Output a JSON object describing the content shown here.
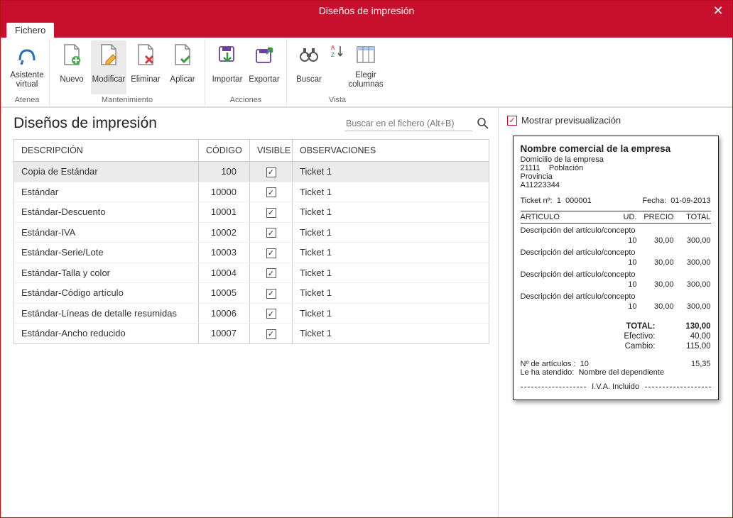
{
  "window": {
    "title": "Diseños de impresión"
  },
  "tabs": [
    {
      "label": "Fichero"
    }
  ],
  "ribbon": {
    "group_atenea": {
      "label": "Atenea",
      "assistant": "Asistente virtual"
    },
    "group_maint": {
      "label": "Mantenimiento",
      "nuevo": "Nuevo",
      "modificar": "Modificar",
      "eliminar": "Eliminar",
      "aplicar": "Aplicar"
    },
    "group_actions": {
      "label": "Acciones",
      "importar": "Importar",
      "exportar": "Exportar"
    },
    "group_view": {
      "label": "Vista",
      "buscar": "Buscar",
      "elegir_cols": "Elegir columnas"
    }
  },
  "main": {
    "title": "Diseños de impresión",
    "search_placeholder": "Buscar en el fichero (Alt+B)",
    "columns": {
      "desc": "DESCRIPCIÓN",
      "code": "CÓDIGO",
      "visible": "VISIBLE",
      "obs": "OBSERVACIONES"
    },
    "rows": [
      {
        "desc": "Copia de Estándar",
        "code": "100",
        "visible": true,
        "obs": "Ticket 1",
        "selected": true
      },
      {
        "desc": "Estándar",
        "code": "10000",
        "visible": true,
        "obs": "Ticket 1"
      },
      {
        "desc": "Estándar-Descuento",
        "code": "10001",
        "visible": true,
        "obs": "Ticket 1"
      },
      {
        "desc": "Estándar-IVA",
        "code": "10002",
        "visible": true,
        "obs": "Ticket 1"
      },
      {
        "desc": "Estándar-Serie/Lote",
        "code": "10003",
        "visible": true,
        "obs": "Ticket 1"
      },
      {
        "desc": "Estándar-Talla y color",
        "code": "10004",
        "visible": true,
        "obs": "Ticket 1"
      },
      {
        "desc": "Estándar-Código artículo",
        "code": "10005",
        "visible": true,
        "obs": "Ticket 1"
      },
      {
        "desc": "Estándar-Líneas de detalle resumidas",
        "code": "10006",
        "visible": true,
        "obs": "Ticket 1"
      },
      {
        "desc": "Estándar-Ancho reducido",
        "code": "10007",
        "visible": true,
        "obs": "Ticket 1"
      }
    ]
  },
  "right": {
    "show_preview": "Mostrar previsualización",
    "preview": {
      "company_name": "Nombre comercial de la empresa",
      "address1": "Domicilio de la empresa",
      "zip": "21111",
      "city": "Población",
      "province": "Provincia",
      "tax_id": "A11223344",
      "ticket_lbl": "Ticket nº:",
      "ticket_series": "1",
      "ticket_num": "000001",
      "date_lbl": "Fecha:",
      "date_val": "01-09-2013",
      "col_articulo": "ARTICULO",
      "col_ud": "UD.",
      "col_precio": "PRECIO",
      "col_total": "TOTAL",
      "item_desc": "Descripción del artículo/concepto",
      "item_ud": "10",
      "item_precio": "30,00",
      "item_total": "300,00",
      "totals": {
        "total_lbl": "TOTAL:",
        "total_val": "130,00",
        "efectivo_lbl": "Efectivo:",
        "efectivo_val": "40,00",
        "cambio_lbl": "Cambio:",
        "cambio_val": "115,00"
      },
      "n_art_lbl": "Nº de artículos :",
      "n_art_val": "10",
      "n_art_extra": "15,35",
      "atendido_lbl": "Le ha atendido:",
      "atendido_val": "Nombre del dependiente",
      "iva": "I.V.A. Incluido"
    }
  }
}
